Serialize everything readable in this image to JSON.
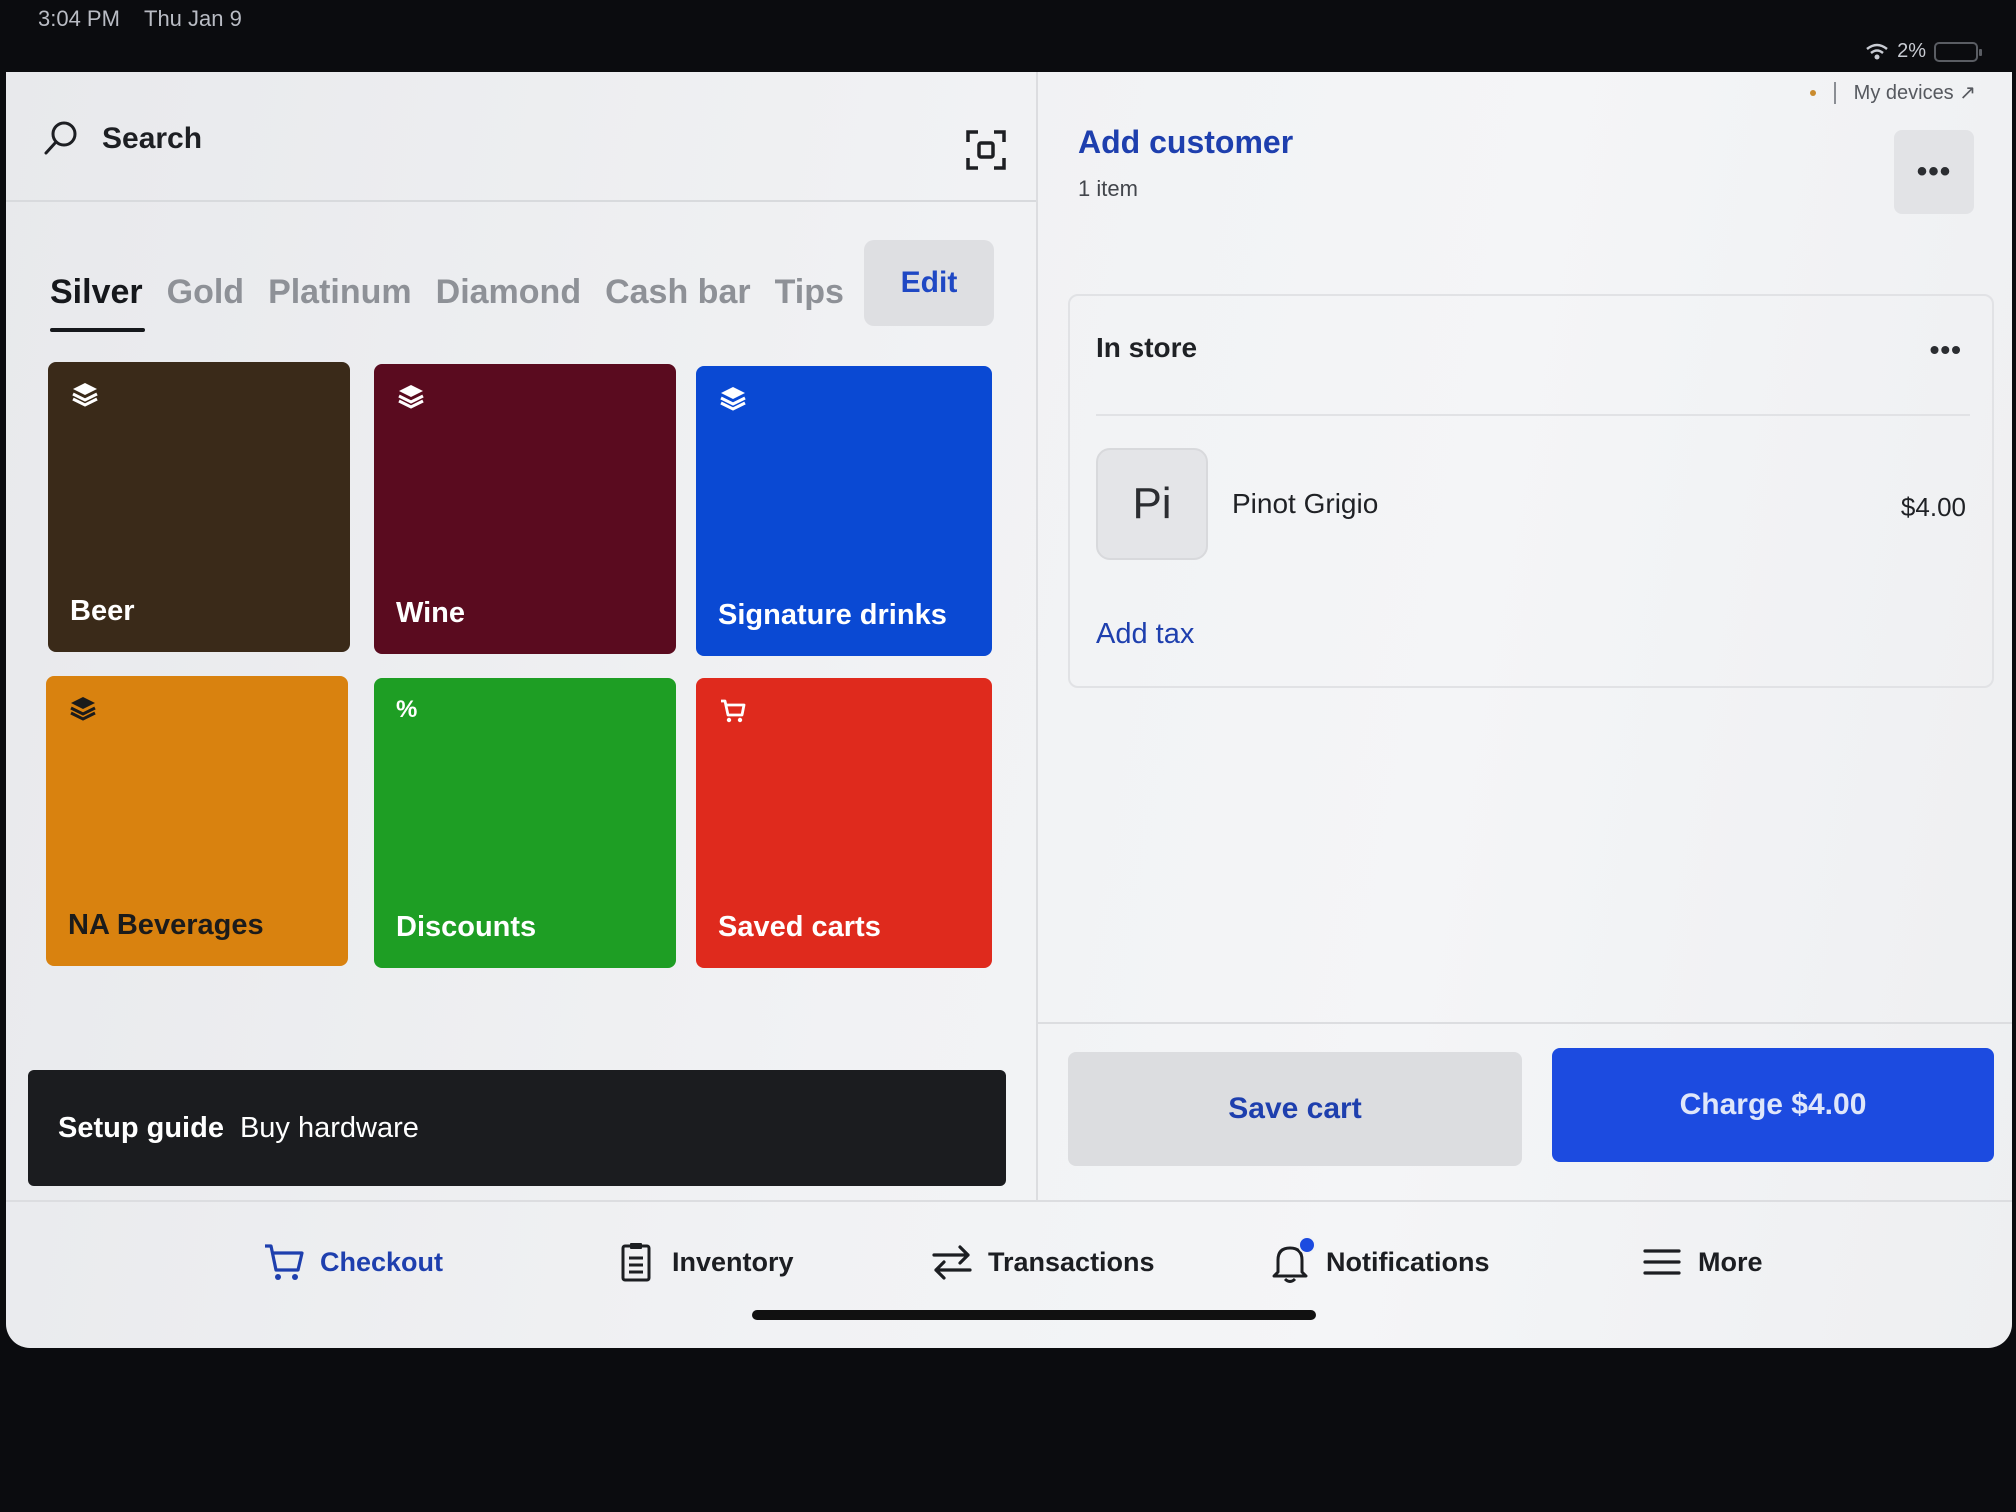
{
  "status": {
    "time": "3:04 PM",
    "date": "Thu Jan 9",
    "battery": "2%"
  },
  "top_info": {
    "my_devices": "My devices ↗"
  },
  "search": {
    "label": "Search"
  },
  "tabs": [
    {
      "label": "Silver",
      "active": true
    },
    {
      "label": "Gold"
    },
    {
      "label": "Platinum"
    },
    {
      "label": "Diamond"
    },
    {
      "label": "Cash bar"
    },
    {
      "label": "Tips"
    }
  ],
  "edit_label": "Edit",
  "tiles": [
    {
      "label": "Beer",
      "icon": "layers-icon",
      "color": "#3a2a19"
    },
    {
      "label": "Wine",
      "icon": "layers-icon",
      "color": "#5a0b1f"
    },
    {
      "label": "Signature drinks",
      "icon": "layers-icon",
      "color": "#0a49d3"
    },
    {
      "label": "NA Beverages",
      "icon": "layers-icon",
      "color": "#d9820f"
    },
    {
      "label": "Discounts",
      "icon": "percent-icon",
      "color": "#1e9e24"
    },
    {
      "label": "Saved carts",
      "icon": "cart-icon",
      "color": "#df2a1d"
    }
  ],
  "setup": {
    "title": "Setup guide",
    "link": "Buy hardware"
  },
  "customer": {
    "add_label": "Add customer",
    "item_count": "1 item"
  },
  "cart": {
    "section_label": "In store",
    "items": [
      {
        "initials": "Pi",
        "name": "Pinot Grigio",
        "price": "$4.00"
      }
    ],
    "add_tax_label": "Add tax"
  },
  "actions": {
    "save_cart": "Save cart",
    "charge": "Charge $4.00"
  },
  "nav": [
    {
      "label": "Checkout",
      "icon": "cart-icon",
      "active": true
    },
    {
      "label": "Inventory",
      "icon": "clipboard-icon"
    },
    {
      "label": "Transactions",
      "icon": "swap-arrows-icon"
    },
    {
      "label": "Notifications",
      "icon": "bell-icon"
    },
    {
      "label": "More",
      "icon": "menu-icon"
    }
  ]
}
